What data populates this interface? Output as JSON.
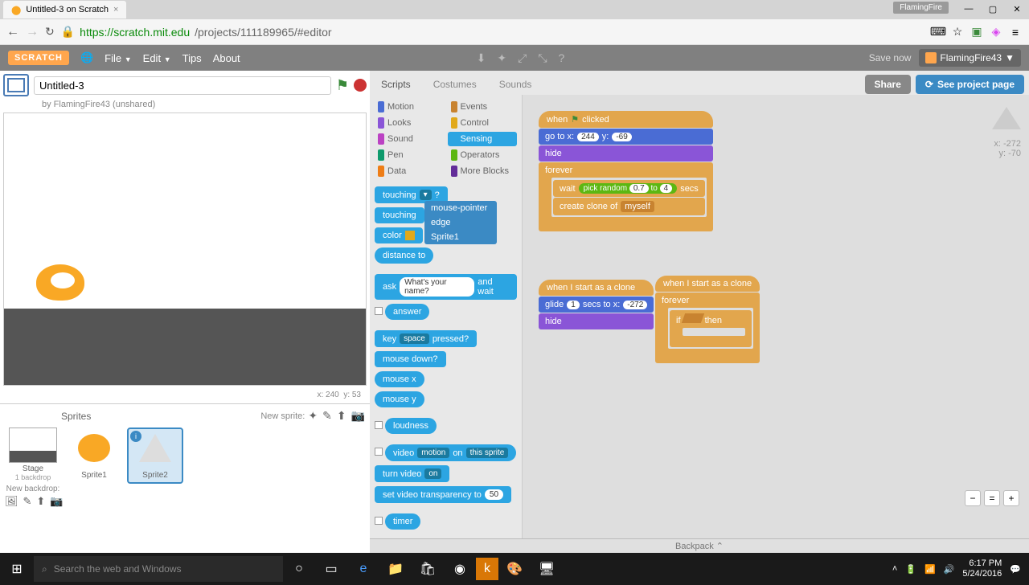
{
  "browser": {
    "tab_title": "Untitled-3 on Scratch",
    "user_tag": "FlamingFire",
    "url_domain": "https://scratch.mit.edu",
    "url_path": "/projects/111189965/#editor"
  },
  "header": {
    "logo": "SCRATCH",
    "file": "File",
    "edit": "Edit",
    "tips": "Tips",
    "about": "About",
    "save_now": "Save now",
    "username": "FlamingFire43"
  },
  "project": {
    "title": "Untitled-3",
    "byline": "by FlamingFire43 (unshared)",
    "stage_x": "x: 240",
    "stage_y": "y: 53"
  },
  "sprites": {
    "label": "Sprites",
    "new_sprite": "New sprite:",
    "stage": "Stage",
    "backdrop_count": "1 backdrop",
    "new_backdrop": "New backdrop:",
    "sprite1": "Sprite1",
    "sprite2": "Sprite2"
  },
  "tabs": {
    "scripts": "Scripts",
    "costumes": "Costumes",
    "sounds": "Sounds",
    "share": "Share",
    "see_page": "See project page"
  },
  "categories": {
    "motion": "Motion",
    "events": "Events",
    "looks": "Looks",
    "control": "Control",
    "sound": "Sound",
    "sensing": "Sensing",
    "pen": "Pen",
    "operators": "Operators",
    "data": "Data",
    "more": "More Blocks"
  },
  "palette_blocks": {
    "touching": "touching",
    "touching_q": "?",
    "touching_color": "touching",
    "color": "color",
    "distance_to": "distance to",
    "ask": "ask",
    "ask_val": "What's your name?",
    "and_wait": "and wait",
    "answer": "answer",
    "key": "key",
    "key_val": "space",
    "pressed": "pressed?",
    "mouse_down": "mouse down?",
    "mouse_x": "mouse x",
    "mouse_y": "mouse y",
    "loudness": "loudness",
    "video": "video",
    "video_motion": "motion",
    "video_on": "on",
    "video_this": "this sprite",
    "turn_video": "turn video",
    "turn_video_val": "on",
    "set_video": "set video transparency to",
    "set_video_val": "50",
    "timer": "timer"
  },
  "dropdown": {
    "mouse_pointer": "mouse-pointer",
    "edge": "edge",
    "sprite1": "Sprite1"
  },
  "canvas": {
    "coords_x": "x: -272",
    "coords_y": "y: -70",
    "when_clicked": "when",
    "clicked": "clicked",
    "go_to": "go to x:",
    "go_x": "244",
    "go_y_lbl": "y:",
    "go_y": "-69",
    "hide": "hide",
    "forever": "forever",
    "wait": "wait",
    "pick_random": "pick random",
    "pr_a": "0.7",
    "pr_to": "to",
    "pr_b": "4",
    "secs": "secs",
    "create_clone": "create clone of",
    "myself": "myself",
    "when_clone": "when I start as a clone",
    "glide": "glide",
    "glide_t": "1",
    "secs_to_x": "secs to x:",
    "glide_x": "-272",
    "if": "if",
    "then": "then"
  },
  "backpack": "Backpack",
  "taskbar": {
    "search_placeholder": "Search the web and Windows",
    "time": "6:17 PM",
    "date": "5/24/2016"
  }
}
